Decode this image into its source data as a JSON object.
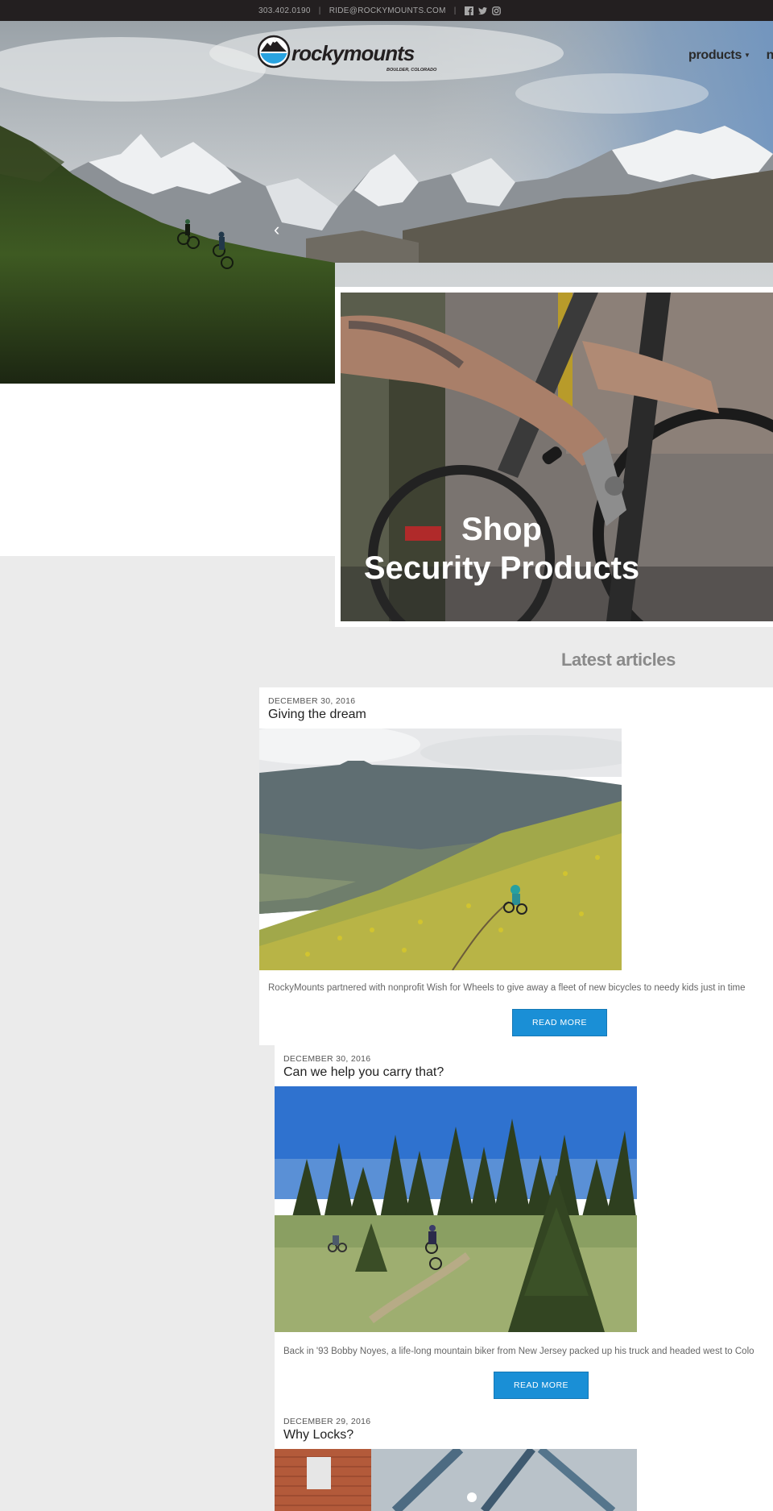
{
  "topbar": {
    "phone": "303.402.0190",
    "email": "RIDE@ROCKYMOUNTS.COM",
    "social": [
      "facebook-icon",
      "twitter-icon",
      "instagram-icon"
    ]
  },
  "brand": {
    "name_part1": "rocky",
    "name_part2": "mounts",
    "tagline": "BOULDER, COLORADO"
  },
  "nav": {
    "items": [
      "products",
      "ne"
    ]
  },
  "promo": {
    "line1": "Shop",
    "line2": "Security Products"
  },
  "latest": {
    "heading": "Latest articles"
  },
  "articles": [
    {
      "date": "DECEMBER 30, 2016",
      "title": "Giving the dream",
      "excerpt": "RockyMounts partnered with nonprofit Wish for Wheels to give away a fleet of new bicycles to needy kids just in time",
      "button": "READ MORE"
    },
    {
      "date": "DECEMBER 30, 2016",
      "title": "Can we help you carry that?",
      "excerpt": "Back in '93 Bobby Noyes, a life-long mountain biker from New Jersey packed up his truck and headed west to Colo",
      "button": "READ MORE"
    },
    {
      "date": "DECEMBER 29, 2016",
      "title": "Why Locks?"
    }
  ],
  "colors": {
    "topbar": "#231f20",
    "accent": "#1a8fd6",
    "page_bg": "#ebebeb"
  }
}
